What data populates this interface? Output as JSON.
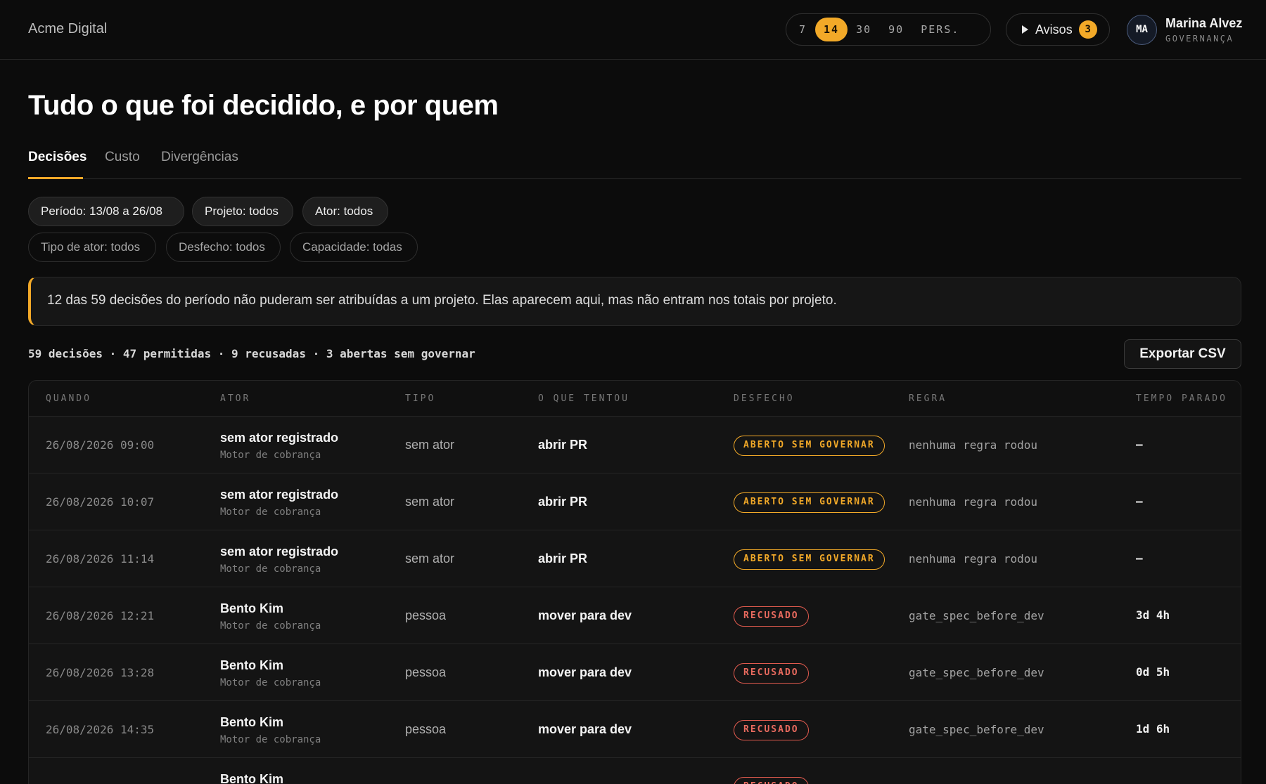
{
  "app": {
    "brand": "Acme Digital"
  },
  "range": {
    "options": [
      "7",
      "14",
      "30",
      "90",
      "PERS."
    ],
    "active": "14"
  },
  "alerts": {
    "label": "Avisos",
    "count": "3"
  },
  "user": {
    "initials": "MA",
    "name": "Marina Alvez",
    "role": "GOVERNANÇA"
  },
  "page": {
    "title": "Tudo o que foi decidido, e por quem"
  },
  "tabs": [
    {
      "label": "Decisões",
      "active": true
    },
    {
      "label": "Custo",
      "active": false
    },
    {
      "label": "Divergências",
      "active": false
    }
  ],
  "filters": {
    "primary": [
      "Período: 13/08 a 26/08",
      "Projeto: todos",
      "Ator: todos"
    ],
    "secondary": [
      "Tipo de ator: todos",
      "Desfecho: todos",
      "Capacidade: todas"
    ]
  },
  "notice": {
    "text": "12 das 59 decisões do período não puderam ser atribuídas a um projeto. Elas aparecem aqui, mas não entram nos totais por projeto."
  },
  "summary": {
    "text": "59 decisões · 47 permitidas · 9 recusadas · 3 abertas sem governar"
  },
  "export": {
    "label": "Exportar CSV"
  },
  "colors": {
    "accent": "#f2a928",
    "denied": "#e05a4e"
  },
  "table": {
    "headers": [
      "QUANDO",
      "ATOR",
      "TIPO",
      "O QUE TENTOU",
      "DESFECHO",
      "REGRA",
      "TEMPO PARADO"
    ],
    "rows": [
      {
        "when": "26/08/2026 09:00",
        "actor": "sem ator registrado",
        "project": "Motor de cobrança",
        "type": "sem ator",
        "what": "abrir PR",
        "outcome": "ABERTO SEM GOVERNAR",
        "outcome_kind": "open",
        "rule": "nenhuma regra rodou",
        "stopped": "—"
      },
      {
        "when": "26/08/2026 10:07",
        "actor": "sem ator registrado",
        "project": "Motor de cobrança",
        "type": "sem ator",
        "what": "abrir PR",
        "outcome": "ABERTO SEM GOVERNAR",
        "outcome_kind": "open",
        "rule": "nenhuma regra rodou",
        "stopped": "—"
      },
      {
        "when": "26/08/2026 11:14",
        "actor": "sem ator registrado",
        "project": "Motor de cobrança",
        "type": "sem ator",
        "what": "abrir PR",
        "outcome": "ABERTO SEM GOVERNAR",
        "outcome_kind": "open",
        "rule": "nenhuma regra rodou",
        "stopped": "—"
      },
      {
        "when": "26/08/2026 12:21",
        "actor": "Bento Kim",
        "project": "Motor de cobrança",
        "type": "pessoa",
        "what": "mover para dev",
        "outcome": "RECUSADO",
        "outcome_kind": "denied",
        "rule": "gate_spec_before_dev",
        "stopped": "3d 4h"
      },
      {
        "when": "26/08/2026 13:28",
        "actor": "Bento Kim",
        "project": "Motor de cobrança",
        "type": "pessoa",
        "what": "mover para dev",
        "outcome": "RECUSADO",
        "outcome_kind": "denied",
        "rule": "gate_spec_before_dev",
        "stopped": "0d 5h"
      },
      {
        "when": "26/08/2026 14:35",
        "actor": "Bento Kim",
        "project": "Motor de cobrança",
        "type": "pessoa",
        "what": "mover para dev",
        "outcome": "RECUSADO",
        "outcome_kind": "denied",
        "rule": "gate_spec_before_dev",
        "stopped": "1d 6h"
      },
      {
        "when": "",
        "actor": "Bento Kim",
        "project": "",
        "type": "",
        "what": "",
        "outcome": "RECUSADO",
        "outcome_kind": "denied",
        "rule": "",
        "stopped": ""
      }
    ]
  }
}
